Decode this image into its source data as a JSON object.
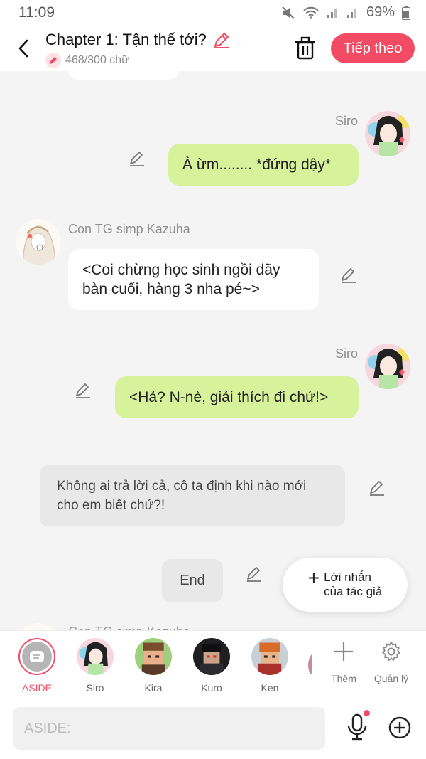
{
  "status_bar": {
    "time": "11:09",
    "battery": "69%"
  },
  "header": {
    "title": "Chapter 1: Tận thế tới?",
    "word_count": "468/300 chữ",
    "next_label": "Tiếp theo"
  },
  "messages": [
    {
      "sender": "Siro",
      "text": "À ừm........ *đứng dậy*"
    },
    {
      "sender": "Con TG simp Kazuha",
      "text": "<Coi chừng học sinh ngồi dãy bàn cuối, hàng 3 nha pé~>"
    },
    {
      "sender": "Siro",
      "text": "<Hả? N-nè, giải thích đi chứ!>"
    },
    {
      "sender": "",
      "text": "Không ai trả lời cả, cô ta định khi nào mới cho em biết chứ?!"
    },
    {
      "sender": "",
      "text": "End"
    }
  ],
  "peek_sender": "Con TG simp Kazuha",
  "author_note_button": {
    "line1": "Lời nhắn",
    "line2": "của tác giả"
  },
  "character_bar": {
    "aside_label": "ASIDE",
    "characters": [
      "Siro",
      "Kira",
      "Kuro",
      "Ken"
    ],
    "add_label": "Thêm",
    "manage_label": "Quản lý"
  },
  "input": {
    "placeholder": "ASIDE:"
  },
  "colors": {
    "accent": "#f24b63",
    "my_bubble": "#d6f29a",
    "aside_bubble": "#e8e8e8"
  },
  "icons": [
    "back-arrow-icon",
    "pencil-icon",
    "trash-icon",
    "edit-icon",
    "plus-icon",
    "gear-icon",
    "mic-icon",
    "add-circle-icon"
  ]
}
